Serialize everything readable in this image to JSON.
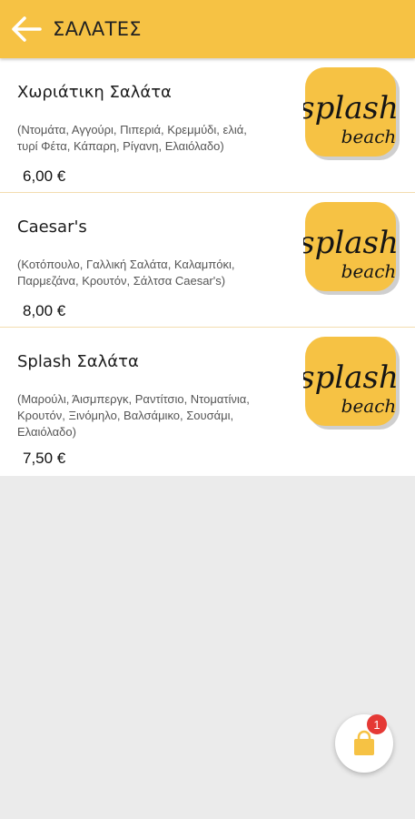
{
  "header": {
    "title": "ΣΑΛΑΤΕΣ",
    "back_icon": "arrow-left-icon"
  },
  "colors": {
    "accent": "#f6c244",
    "badge": "#e53935"
  },
  "logo_text": {
    "line1": "splash",
    "line2": "beach"
  },
  "items": [
    {
      "name": "Χωριάτικη Σαλάτα",
      "desc_line1": "(Ντομάτα, Αγγούρι, Πιπεριά, Κρεμμύδι, ελιά,",
      "desc_line2": "τυρί Φέτα, Κάπαρη, Ρίγανη, Ελαιόλαδο)",
      "price": "6,00 €"
    },
    {
      "name": "Caesar's",
      "desc_line1": "(Κοτόπουλο, Γαλλική Σαλάτα, Καλαμπόκι,",
      "desc_line2": "Παρμεζάνα, Κρουτόν, Σάλτσα Caesar's)",
      "price": "8,00 €"
    },
    {
      "name": "Splash Σαλάτα",
      "desc_line1": "(Μαρούλι, Άισμπεργκ, Ραντίτσιο, Ντοματίνια,",
      "desc_line2": "Κρουτόν, Ξινόμηλο, Βαλσάμικο, Σουσάμι,",
      "desc_line3": "Ελαιόλαδο)",
      "price": "7,50 €"
    }
  ],
  "cart": {
    "count": "1",
    "icon": "shopping-bag-icon"
  }
}
